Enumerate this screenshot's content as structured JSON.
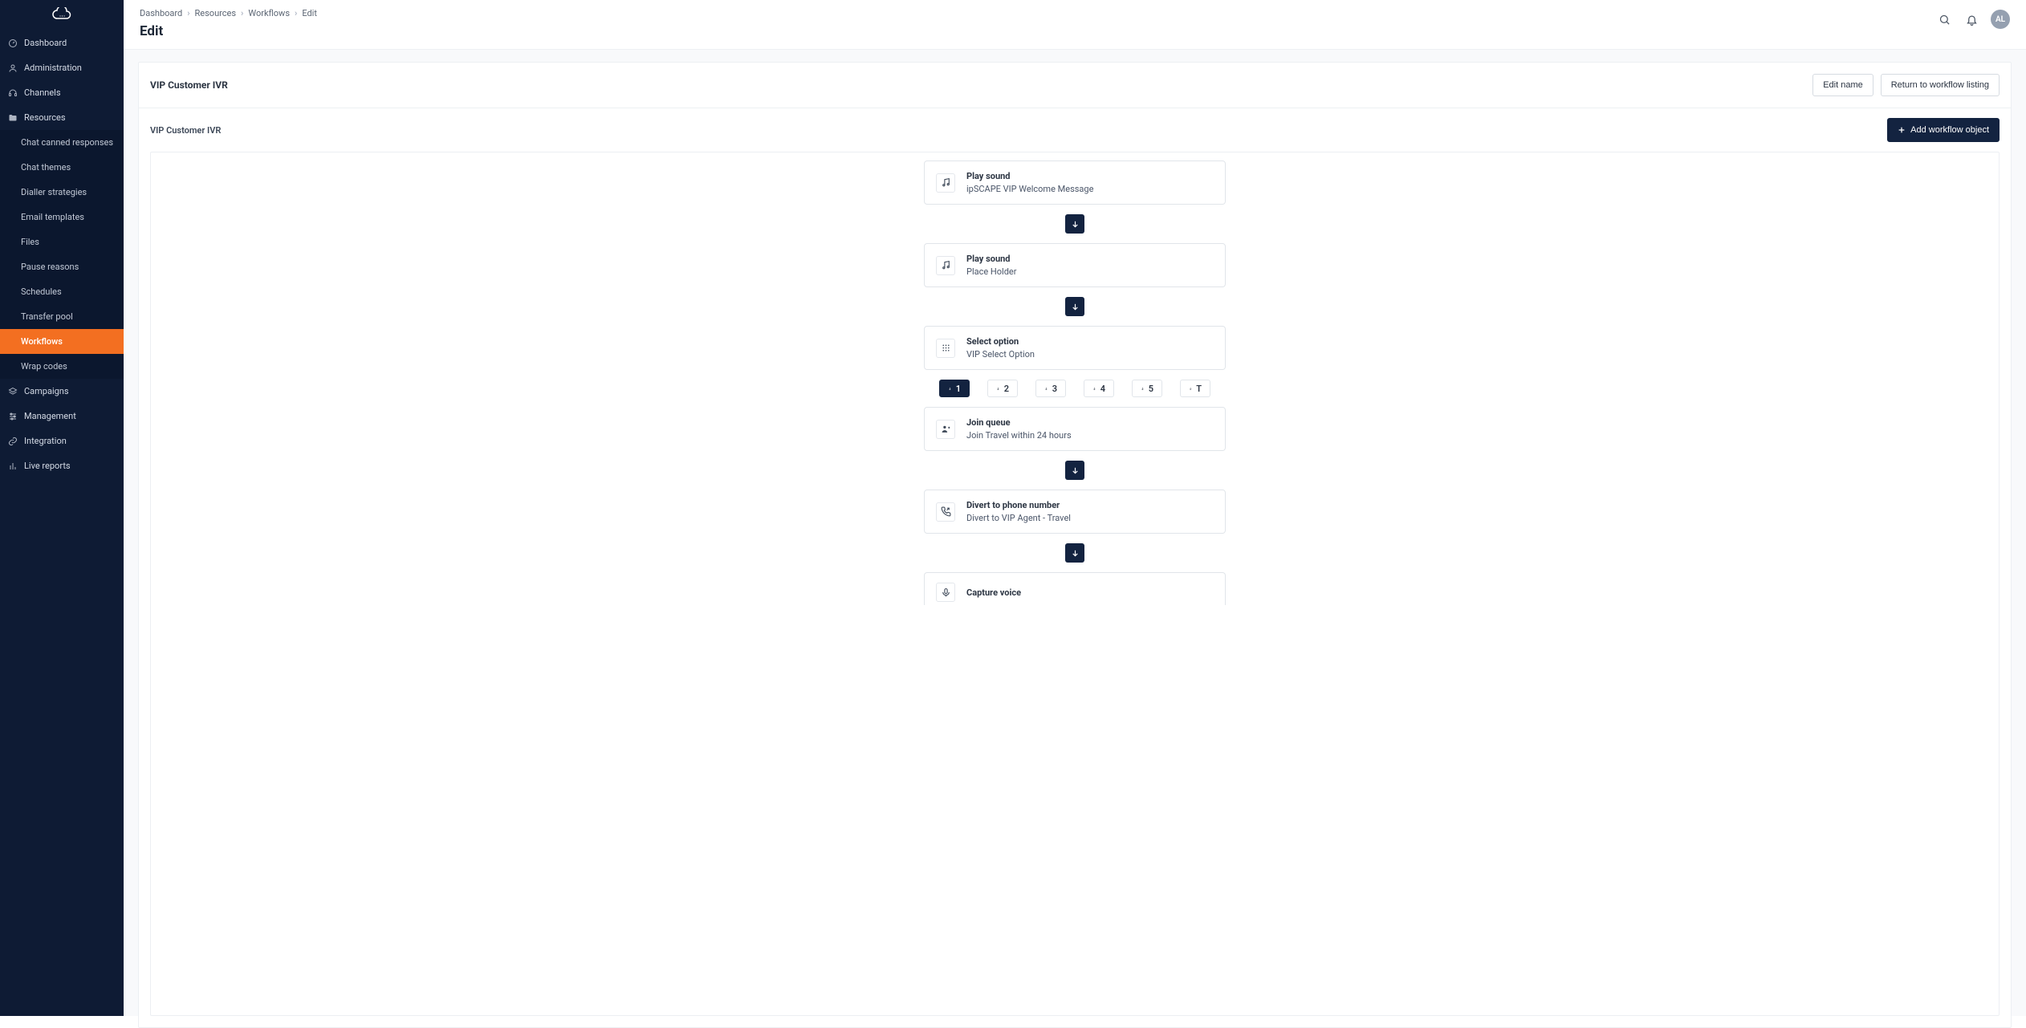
{
  "breadcrumbs": [
    "Dashboard",
    "Resources",
    "Workflows",
    "Edit"
  ],
  "page_title": "Edit",
  "avatar": "AL",
  "sidebar": {
    "main_items": [
      {
        "label": "Dashboard",
        "icon": "gauge"
      },
      {
        "label": "Administration",
        "icon": "user"
      },
      {
        "label": "Channels",
        "icon": "headset"
      },
      {
        "label": "Resources",
        "icon": "folder",
        "expanded": true
      },
      {
        "label": "Campaigns",
        "icon": "layers"
      },
      {
        "label": "Management",
        "icon": "sliders"
      },
      {
        "label": "Integration",
        "icon": "link"
      },
      {
        "label": "Live reports",
        "icon": "bar-chart"
      }
    ],
    "resources_sub": [
      "Chat canned responses",
      "Chat themes",
      "Dialler strategies",
      "Email templates",
      "Files",
      "Pause reasons",
      "Schedules",
      "Transfer pool",
      "Workflows",
      "Wrap codes"
    ],
    "resources_active": "Workflows"
  },
  "workflow": {
    "name": "VIP Customer IVR",
    "breadcrumb_label": "VIP Customer IVR",
    "buttons": {
      "edit_name": "Edit name",
      "return": "Return to workflow listing",
      "add_object": "Add workflow object"
    },
    "select_options": [
      "1",
      "2",
      "3",
      "4",
      "5",
      "T"
    ],
    "select_active": "1",
    "nodes": [
      {
        "icon": "music",
        "title": "Play sound",
        "sub": "ipSCAPE VIP Welcome Message"
      },
      {
        "icon": "music",
        "title": "Play sound",
        "sub": "Place Holder"
      },
      {
        "icon": "grid",
        "title": "Select option",
        "sub": "VIP Select Option"
      },
      {
        "icon": "queue",
        "title": "Join queue",
        "sub": "Join Travel within 24 hours"
      },
      {
        "icon": "phone-forward",
        "title": "Divert to phone number",
        "sub": "Divert to VIP Agent - Travel"
      },
      {
        "icon": "mic",
        "title": "Capture voice",
        "sub": ""
      }
    ]
  }
}
